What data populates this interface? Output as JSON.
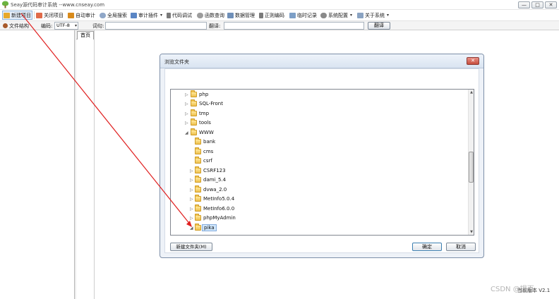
{
  "window": {
    "title": "Seay源代码审计系统 --www.cnseay.com",
    "minimize_glyph": "—",
    "restore_glyph": "□",
    "close_glyph": "✕"
  },
  "toolbar": {
    "items": [
      {
        "label": "新建项目",
        "icon": "folder-plus-icon",
        "color": "#e7a82a"
      },
      {
        "label": "关闭项目",
        "icon": "close-x-icon",
        "color": "#e06b4a"
      },
      {
        "label": "自动审计",
        "icon": "audit-icon",
        "color": "#d98b1c"
      },
      {
        "label": "全局搜索",
        "icon": "search-bubble-icon",
        "color": "#8fa7c8"
      },
      {
        "label": "审计插件",
        "icon": "plugin-icon",
        "color": "#5a86c5"
      },
      {
        "label": "代码调试",
        "icon": "debug-icon",
        "color": "#7a7a7a"
      },
      {
        "label": "函数查询",
        "icon": "magnifier-icon",
        "color": "#9c9c9c"
      },
      {
        "label": "数据管理",
        "icon": "database-icon",
        "color": "#6f8fb8"
      },
      {
        "label": "正则编码",
        "icon": "regex-icon",
        "color": "#7a7a7a"
      },
      {
        "label": "临时记录",
        "icon": "notes-icon",
        "color": "#7d9fc7"
      },
      {
        "label": "系统配置",
        "icon": "gear-icon",
        "color": "#8a8a8a"
      },
      {
        "label": "关于系统",
        "icon": "about-icon",
        "color": "#8aa3c2"
      }
    ]
  },
  "bar2": {
    "file_structure_label": "文件结构",
    "encoding_label": "编码:",
    "encoding_value": "UTF-8",
    "word_label": "词句:",
    "word_value": "",
    "translate_label": "翻译:",
    "translate_value": "",
    "translate_button": "翻译"
  },
  "tabs": [
    {
      "label": "首页"
    }
  ],
  "dialog": {
    "title": "浏览文件夹",
    "close_glyph": "✕",
    "tree": [
      {
        "name": "php",
        "level": 1,
        "expander": "▷"
      },
      {
        "name": "SQL-Front",
        "level": 1,
        "expander": "▷"
      },
      {
        "name": "tmp",
        "level": 1,
        "expander": "▷"
      },
      {
        "name": "tools",
        "level": 1,
        "expander": "▷"
      },
      {
        "name": "WWW",
        "level": 1,
        "expander": "◢"
      },
      {
        "name": "bank",
        "level": 2,
        "expander": ""
      },
      {
        "name": "cms",
        "level": 2,
        "expander": ""
      },
      {
        "name": "csrf",
        "level": 2,
        "expander": ""
      },
      {
        "name": "CSRF123",
        "level": 2,
        "expander": "▷"
      },
      {
        "name": "dami_5.4",
        "level": 2,
        "expander": "▷"
      },
      {
        "name": "dvwa_2.0",
        "level": 2,
        "expander": "▷"
      },
      {
        "name": "MetInfo5.0.4",
        "level": 2,
        "expander": "▷"
      },
      {
        "name": "MetInfo6.0.0",
        "level": 2,
        "expander": "▷"
      },
      {
        "name": "phpMyAdmin",
        "level": 2,
        "expander": "▷"
      },
      {
        "name": "pika",
        "level": 2,
        "expander": "◢",
        "selected": true
      }
    ],
    "new_folder_button": "新建文件夹(M)",
    "ok_button": "确定",
    "cancel_button": "取消"
  },
  "status": {
    "version_text": "当前版本 V2.1",
    "watermark": "CSDN @提百"
  },
  "colors": {
    "accent_arrow": "#e02020",
    "selection": "#cfe6fb"
  }
}
